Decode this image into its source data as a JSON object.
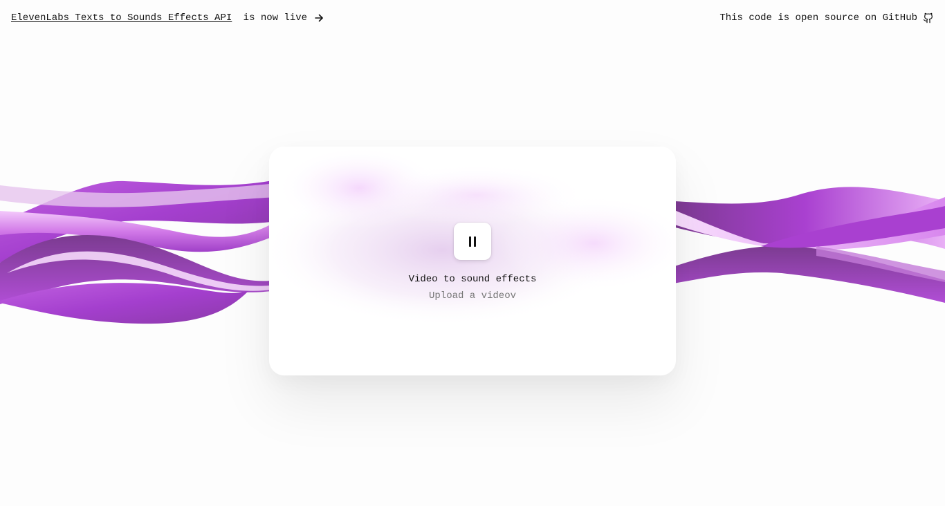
{
  "header": {
    "announcement_link": "ElevenLabs Texts to Sounds Effects API",
    "announcement_suffix": " is now live",
    "arrow_icon": "arrow-right-icon",
    "open_source_text": "This code is open source on GitHub",
    "github_icon": "github-icon"
  },
  "card": {
    "play_state_icon": "pause-icon",
    "title": "Video to sound effects",
    "subtitle": "Upload a videov"
  },
  "colors": {
    "wave_primary": "#a940d0",
    "wave_light": "#e7a8f5",
    "wave_dark": "#7a3a8e",
    "background": "#fdfdfd"
  }
}
